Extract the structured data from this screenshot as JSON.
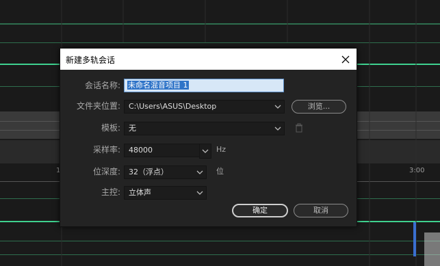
{
  "background": {
    "timecode_left": "1",
    "timecode_right": "3:00"
  },
  "dialog": {
    "title": "新建多轨会话",
    "fields": {
      "session_name": {
        "label": "会话名称:",
        "value": "未命名混音项目 1"
      },
      "folder": {
        "label": "文件夹位置:",
        "value": "C:\\Users\\ASUS\\Desktop",
        "browse": "浏览..."
      },
      "template": {
        "label": "模板:",
        "value": "无"
      },
      "sample_rate": {
        "label": "采样率:",
        "value": "48000",
        "unit": "Hz"
      },
      "bit_depth": {
        "label": "位深度:",
        "value": "32（浮点）",
        "unit": "位"
      },
      "master": {
        "label": "主控:",
        "value": "立体声"
      }
    },
    "buttons": {
      "ok": "确定",
      "cancel": "取消"
    }
  },
  "colors": {
    "waveform": "#3fd18f",
    "dialog_bg": "#232323",
    "selection": "#2f74c8"
  }
}
